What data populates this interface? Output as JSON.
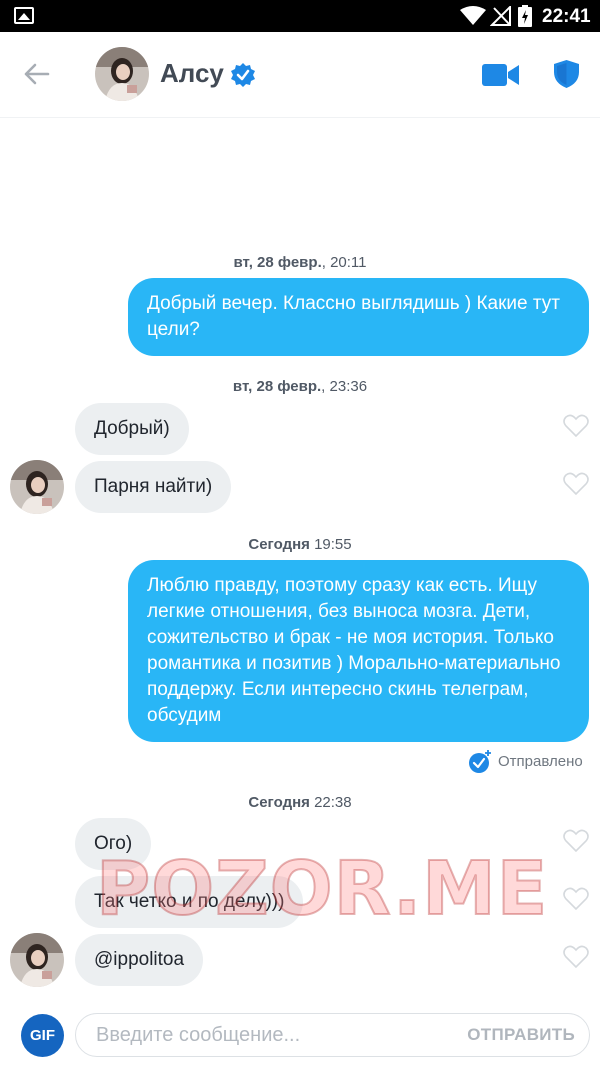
{
  "status_bar": {
    "time": "22:41"
  },
  "header": {
    "contact_name": "Алсу"
  },
  "messages": [
    {
      "type": "timestamp",
      "date": "вт, 28 февр.",
      "time": "20:11"
    },
    {
      "type": "out",
      "text": "Добрый вечер. Классно выглядишь ) Какие тут цели?"
    },
    {
      "type": "timestamp",
      "date": "вт, 28 февр.",
      "time": "23:36"
    },
    {
      "type": "in",
      "text": "Добрый)"
    },
    {
      "type": "in",
      "text": "Парня найти)"
    },
    {
      "type": "timestamp",
      "date": "Сегодня",
      "time": "19:55"
    },
    {
      "type": "out",
      "text": "Люблю правду, поэтому сразу как есть. Ищу легкие отношения, без выноса мозга. Дети, сожительство и брак - не моя история. Только романтика и позитив ) Морально-материально поддержу. Если интересно скинь телеграм, обсудим"
    },
    {
      "type": "status",
      "text": "Отправлено"
    },
    {
      "type": "timestamp",
      "date": "Сегодня",
      "time": "22:38"
    },
    {
      "type": "in",
      "text": "Ого)"
    },
    {
      "type": "in",
      "text": "Так четко и по делу)))"
    },
    {
      "type": "in",
      "text": "@ippolitoa"
    }
  ],
  "watermark": "POZOR.ME",
  "composer": {
    "gif_label": "GIF",
    "placeholder": "Введите сообщение...",
    "send_label": "ОТПРАВИТЬ"
  },
  "colors": {
    "outgoing_bubble": "#29b6f6",
    "incoming_bubble": "#eceff1",
    "accent": "#1e88e5"
  }
}
